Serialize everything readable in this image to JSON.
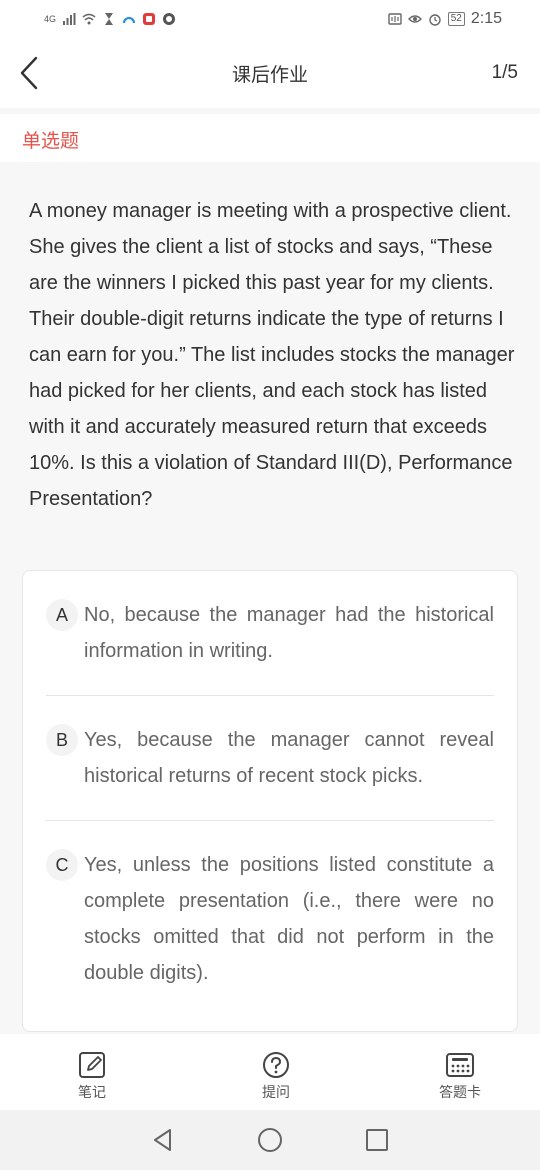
{
  "status_bar": {
    "network": "4G",
    "battery": "52",
    "time": "2:15"
  },
  "header": {
    "title": "课后作业",
    "page_counter": "1/5"
  },
  "question_type": "单选题",
  "question": "A money manager is meeting with a prospective client. She gives the client a list of stocks and says, “These are the winners I picked this past year for my clients. Their double-digit returns indicate the type of returns I can earn for you.” The list includes stocks the manager had picked for her clients, and each stock has listed with it and accurately measured return that exceeds 10%. Is this a violation of Standard III(D), Performance Presentation?",
  "options": [
    {
      "letter": "A",
      "text": "No, because the manager had the historical information in writing."
    },
    {
      "letter": "B",
      "text": "Yes, because the manager cannot reveal historical returns of recent stock picks."
    },
    {
      "letter": "C",
      "text": "Yes, unless the positions listed constitute a complete presentation (i.e., there were no stocks omitted that did not perform in the double digits)."
    }
  ],
  "bottom_tabs": [
    {
      "label": "笔记",
      "icon": "note-edit-icon"
    },
    {
      "label": "提问",
      "icon": "question-icon"
    },
    {
      "label": "答题卡",
      "icon": "answer-card-icon"
    }
  ],
  "colors": {
    "accent": "#e4544c",
    "background": "#f7f7f7"
  }
}
